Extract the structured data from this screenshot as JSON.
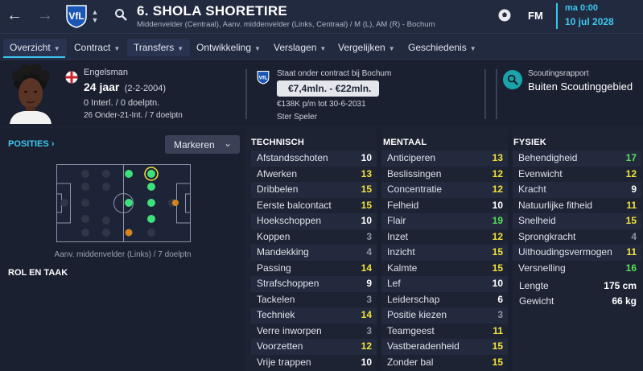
{
  "topbar": {
    "player_title": "6. SHOLA SHORETIRE",
    "subtitle": "Middenvelder (Centraal), Aanv. middenvelder (Links, Centraal) / M (L), AM (R) - Bochum",
    "fm_label": "FM",
    "time": "ma 0:00",
    "date": "10 jul 2028"
  },
  "tabs": [
    {
      "label": "Overzicht"
    },
    {
      "label": "Contract"
    },
    {
      "label": "Transfers"
    },
    {
      "label": "Ontwikkeling"
    },
    {
      "label": "Verslagen"
    },
    {
      "label": "Vergelijken"
    },
    {
      "label": "Geschiedenis"
    }
  ],
  "profile": {
    "nationality": "Engelsman",
    "age": "24 jaar",
    "dob": "(2-2-2004)",
    "caps": "0 Interl. / 0 doelptn.",
    "u21": "26 Onder-21-Int. / 7 doelptn"
  },
  "contract": {
    "label": "Staat onder contract bij Bochum",
    "value_range": "€7,4mln. - €22mln.",
    "wage": "€138K p/m tot 30-6-2031",
    "status": "Ster Speler"
  },
  "scouting": {
    "label": "Scoutingsrapport",
    "value": "Buiten Scoutinggebied"
  },
  "positions": {
    "title": "POSITIES",
    "dropdown": "Markeren",
    "caption": "Aanv. middenvelder (Links) / 7 doelptn",
    "role_title": "ROL EN TAAK"
  },
  "technical": {
    "title": "TECHNISCH",
    "rows": [
      {
        "name": "Afstandsschoten",
        "value": "10"
      },
      {
        "name": "Afwerken",
        "value": "13"
      },
      {
        "name": "Dribbelen",
        "value": "15"
      },
      {
        "name": "Eerste balcontact",
        "value": "15"
      },
      {
        "name": "Hoekschoppen",
        "value": "10"
      },
      {
        "name": "Koppen",
        "value": "3"
      },
      {
        "name": "Mandekking",
        "value": "4"
      },
      {
        "name": "Passing",
        "value": "14"
      },
      {
        "name": "Strafschoppen",
        "value": "9"
      },
      {
        "name": "Tackelen",
        "value": "3"
      },
      {
        "name": "Techniek",
        "value": "14"
      },
      {
        "name": "Verre inworpen",
        "value": "3"
      },
      {
        "name": "Voorzetten",
        "value": "12"
      },
      {
        "name": "Vrije trappen",
        "value": "10"
      }
    ]
  },
  "mental": {
    "title": "MENTAAL",
    "rows": [
      {
        "name": "Anticiperen",
        "value": "13"
      },
      {
        "name": "Beslissingen",
        "value": "12"
      },
      {
        "name": "Concentratie",
        "value": "12"
      },
      {
        "name": "Felheid",
        "value": "10"
      },
      {
        "name": "Flair",
        "value": "19"
      },
      {
        "name": "Inzet",
        "value": "12"
      },
      {
        "name": "Inzicht",
        "value": "15"
      },
      {
        "name": "Kalmte",
        "value": "15"
      },
      {
        "name": "Lef",
        "value": "10"
      },
      {
        "name": "Leiderschap",
        "value": "6"
      },
      {
        "name": "Positie kiezen",
        "value": "3"
      },
      {
        "name": "Teamgeest",
        "value": "11"
      },
      {
        "name": "Vastberadenheid",
        "value": "15"
      },
      {
        "name": "Zonder bal",
        "value": "15"
      }
    ]
  },
  "physical": {
    "title": "FYSIEK",
    "rows": [
      {
        "name": "Behendigheid",
        "value": "17"
      },
      {
        "name": "Evenwicht",
        "value": "12"
      },
      {
        "name": "Kracht",
        "value": "9"
      },
      {
        "name": "Natuurlijke fitheid",
        "value": "11"
      },
      {
        "name": "Snelheid",
        "value": "15"
      },
      {
        "name": "Sprongkracht",
        "value": "4"
      },
      {
        "name": "Uithoudingsvermogen",
        "value": "11"
      },
      {
        "name": "Versnelling",
        "value": "16"
      }
    ],
    "height_label": "Lengte",
    "height": "175 cm",
    "weight_label": "Gewicht",
    "weight": "66 kg"
  },
  "colors": {
    "accent": "#3cc8f0",
    "white_value": "#ffffff",
    "yellow_value": "#f2e23a",
    "green_value": "#55e05a",
    "grey_value": "#8d93a3",
    "pos_natural": "#3ee07a",
    "pos_accomplished": "#d4841a"
  },
  "icons": [
    "back-arrow-icon",
    "forward-arrow-icon",
    "club-crest-icon",
    "search-icon",
    "ball-icon",
    "england-flag-icon",
    "scouting-search-icon"
  ]
}
